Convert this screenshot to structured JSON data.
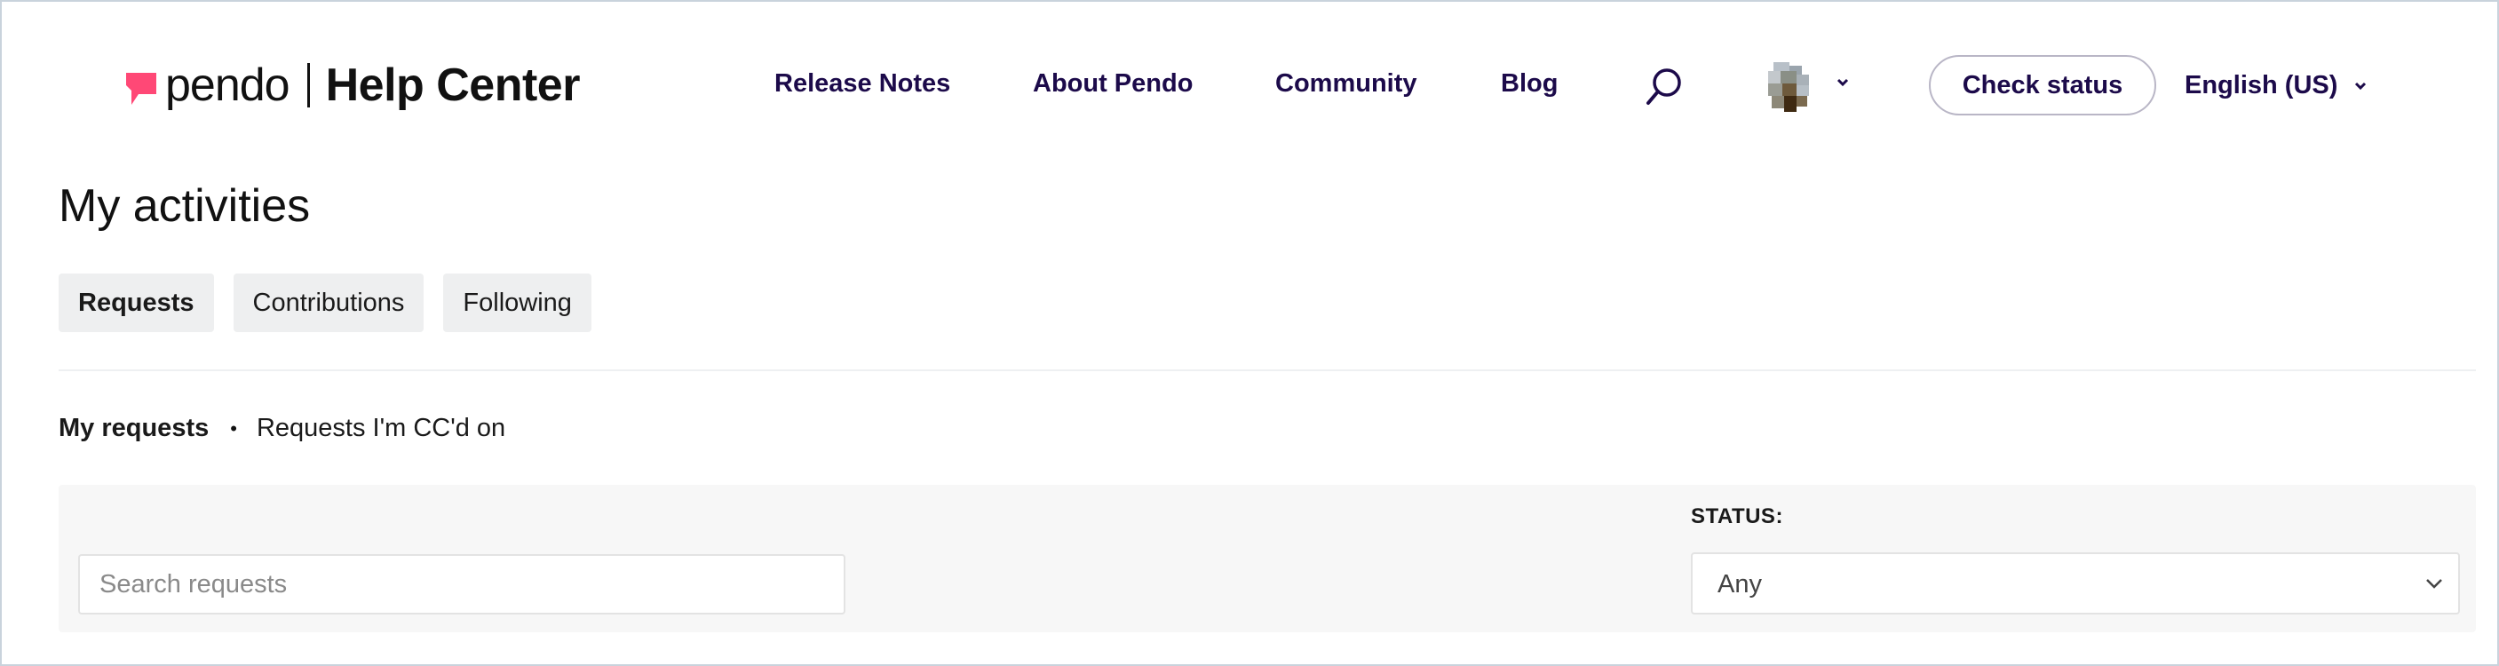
{
  "brand": {
    "word": "pendo",
    "title": "Help Center",
    "logo_color": "#ff4876"
  },
  "nav": {
    "links": [
      {
        "label": "Release Notes"
      },
      {
        "label": "About Pendo"
      },
      {
        "label": "Community"
      },
      {
        "label": "Blog"
      }
    ],
    "search_icon": "search-icon",
    "check_status": "Check status",
    "language": "English (US)",
    "text_color": "#1c0a4a"
  },
  "page": {
    "title": "My activities",
    "tabs": [
      {
        "label": "Requests",
        "active": true
      },
      {
        "label": "Contributions",
        "active": false
      },
      {
        "label": "Following",
        "active": false
      }
    ],
    "subnav": {
      "selected": "My requests",
      "separator": "•",
      "other": "Requests I'm CC'd on"
    },
    "filters": {
      "search_placeholder": "Search requests",
      "status_label": "STATUS:",
      "status_value": "Any"
    }
  }
}
